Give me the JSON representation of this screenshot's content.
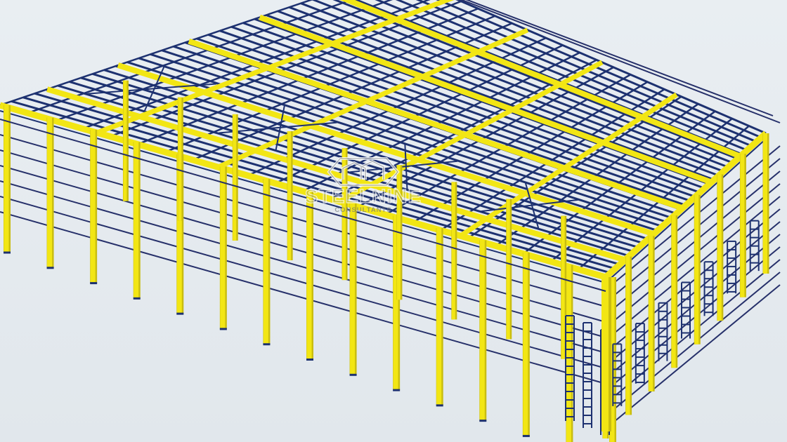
{
  "scene": {
    "description_type": "3d-structural-steel-model",
    "colors": {
      "background": "#e4e9ee",
      "primary_members": "#f2e614",
      "primary_members_shade": "#c9bd10",
      "secondary_members": "#1d3170",
      "cladding_rails": "#26306a"
    }
  },
  "watermark": {
    "brand": "STEELNINE",
    "tagline": "CONSULTANTS",
    "logo_icon": "hexagon-building-logo"
  }
}
